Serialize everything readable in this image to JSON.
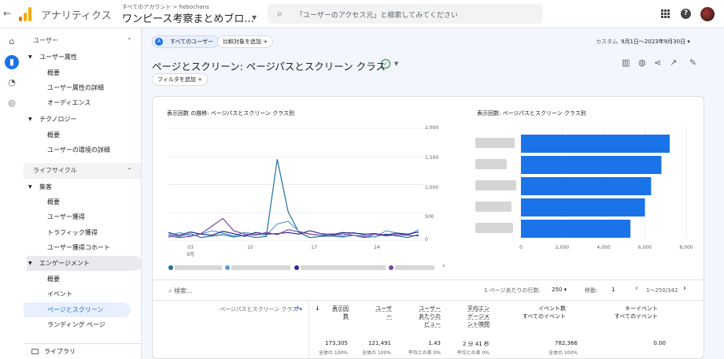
{
  "app": {
    "name": "アナリティクス",
    "account_path": "すべてのアカウント > hebochans",
    "property": "ワンピース考察まとめブロ...",
    "search_placeholder": "「ユーザーのアクセス元」と検索してみてください"
  },
  "sidebar": {
    "sections": [
      {
        "label": "ユーザー"
      },
      {
        "label": "ライフサイクル"
      }
    ],
    "groups": [
      {
        "label": "ユーザー属性"
      },
      {
        "label": "テクノロジー"
      },
      {
        "label": "集客"
      },
      {
        "label": "エンゲージメント"
      }
    ],
    "items": [
      {
        "label": "概要"
      },
      {
        "label": "ユーザー属性の詳細"
      },
      {
        "label": "オーディエンス"
      },
      {
        "label": "概要"
      },
      {
        "label": "ユーザーの環境の詳細"
      },
      {
        "label": "概要"
      },
      {
        "label": "ユーザー獲得"
      },
      {
        "label": "トラフィック獲得"
      },
      {
        "label": "ユーザー獲得コホート"
      },
      {
        "label": "概要"
      },
      {
        "label": "イベント"
      },
      {
        "label": "ページとスクリーン"
      },
      {
        "label": "ランディング ページ"
      }
    ],
    "library": "ライブラリ"
  },
  "toolbar": {
    "segment_chip": "すべてのユーザー",
    "compare_chip": "比較対象を追加",
    "filter_chip": "フィルタを追加",
    "date_label": "カスタム",
    "date_range": "9月1日～2023年9月30日"
  },
  "page": {
    "title": "ページとスクリーン: ページパスとスクリーン クラス"
  },
  "chart_data": [
    {
      "type": "line",
      "title": "表示回数 の推移: ページパスとスクリーン クラス別",
      "x_ticks": [
        "03\n9月",
        "10",
        "17",
        "24"
      ],
      "yticks": [
        "2,000",
        "1,500",
        "1,000",
        "500",
        "0"
      ],
      "ylim": [
        0,
        2000
      ],
      "legend_position": "bottom",
      "series": [
        {
          "color": "#1f6f9e",
          "values": [
            120,
            80,
            130,
            60,
            90,
            110,
            70,
            100,
            60,
            80,
            1450,
            520,
            150,
            60,
            80,
            90,
            70,
            100,
            60,
            80,
            120,
            90,
            60,
            110
          ]
        },
        {
          "color": "#5a9bd5",
          "values": [
            60,
            150,
            90,
            120,
            180,
            140,
            90,
            150,
            120,
            100,
            300,
            350,
            170,
            120,
            100,
            130,
            90,
            150,
            100,
            70,
            180,
            140,
            100,
            200
          ]
        },
        {
          "color": "#2b2d8f",
          "values": [
            150,
            100,
            160,
            120,
            100,
            170,
            130,
            80,
            150,
            120,
            130,
            150,
            120,
            180,
            130,
            110,
            150,
            140,
            120,
            130,
            100,
            140,
            120,
            160
          ]
        },
        {
          "color": "#7b3fa0",
          "values": [
            90,
            60,
            80,
            130,
            260,
            400,
            180,
            120,
            100,
            150,
            110,
            200,
            160,
            120,
            100,
            90,
            130,
            100,
            80,
            120,
            90,
            110,
            100,
            90
          ]
        }
      ]
    },
    {
      "type": "bar",
      "orientation": "horizontal",
      "title": "表示回数: ページパスとスクリーン クラス別",
      "values": [
        7200,
        6800,
        6300,
        6000,
        5300
      ],
      "xticks": [
        "0",
        "2,000",
        "4,000",
        "6,000",
        "8,000"
      ],
      "xlim": [
        0,
        8000
      ],
      "color": "#1a73e8"
    }
  ],
  "table": {
    "search_placeholder": "検索...",
    "rows_per_page_label": "1 ページあたりの行数:",
    "rows_per_page": "250",
    "goto_label": "移動:",
    "goto_value": "1",
    "range": "1〜250/342",
    "dimension_header": "ページパスとスクリーン クラス",
    "headers": [
      {
        "label": "表示回\n数"
      },
      {
        "label": "ユーザ\nー"
      },
      {
        "label": "ユーザー\nあたりの\nビュー"
      },
      {
        "label": "平均エン\nゲージメ\nント時間"
      },
      {
        "label": "イベント数\nすべてのイベント"
      },
      {
        "label": "キーイベント\nすべてのイベント"
      }
    ],
    "totals": [
      {
        "value": "173,305",
        "sub": "全体の 100%"
      },
      {
        "value": "121,491",
        "sub": "全体の 100%"
      },
      {
        "value": "1.43",
        "sub": "平均との差 0%"
      },
      {
        "value": "2 分 41 秒",
        "sub": "平均との差 0%"
      },
      {
        "value": "782,366",
        "sub": "全体の 100%"
      },
      {
        "value": "0.00",
        "sub": ""
      }
    ]
  },
  "colors": {
    "accent": "#1a73e8",
    "check": "#188038"
  }
}
